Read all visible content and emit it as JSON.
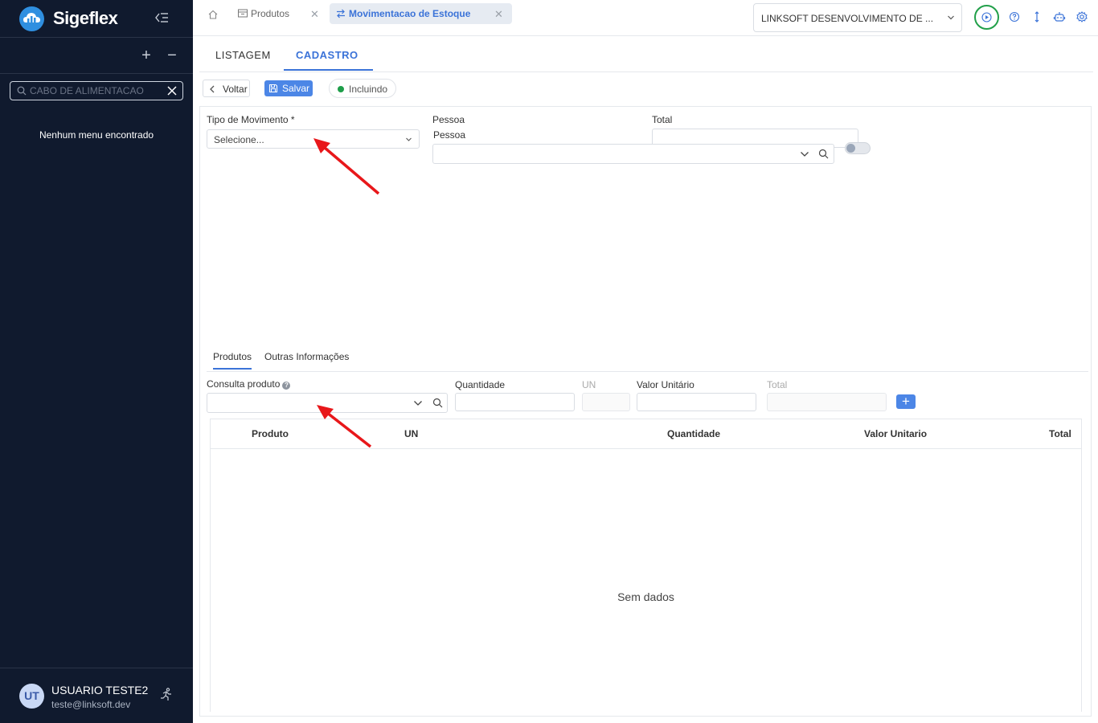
{
  "sidebar": {
    "brand": "Sigeflex",
    "search_placeholder": "CABO DE ALIMENTACAO",
    "empty_text": "Nenhum menu encontrado",
    "user": {
      "initials": "UT",
      "name": "USUARIO TESTE2",
      "email": "teste@linksoft.dev"
    }
  },
  "topbar": {
    "tabs": [
      {
        "label": "Produtos"
      },
      {
        "label": "Movimentacao de Estoque",
        "active": true
      }
    ],
    "company": "LINKSOFT DESENVOLVIMENTO DE ..."
  },
  "page_tabs": [
    "LISTAGEM",
    "CADASTRO"
  ],
  "actions": {
    "back": "Voltar",
    "save": "Salvar",
    "status": "Incluindo"
  },
  "form": {
    "tipo_label": "Tipo de Movimento *",
    "tipo_placeholder": "Selecione...",
    "pessoa_label": "Pessoa",
    "pessoa_sublabel": "Pessoa",
    "total_label": "Total"
  },
  "subtabs": [
    "Produtos",
    "Outras Informações"
  ],
  "product_entry": {
    "consulta_label": "Consulta produto",
    "quantidade_label": "Quantidade",
    "un_label": "UN",
    "valor_label": "Valor Unitário",
    "total_label": "Total",
    "add_symbol": "+"
  },
  "grid": {
    "columns": [
      "Produto",
      "UN",
      "Quantidade",
      "Valor Unitario",
      "Total"
    ],
    "empty_text": "Sem dados"
  },
  "colors": {
    "sidebar_bg": "#101a2e",
    "accent": "#3b73d8",
    "primary_button": "#4c86e6",
    "status_dot": "#1e9e4a",
    "annotation_arrow": "#e8171a"
  }
}
